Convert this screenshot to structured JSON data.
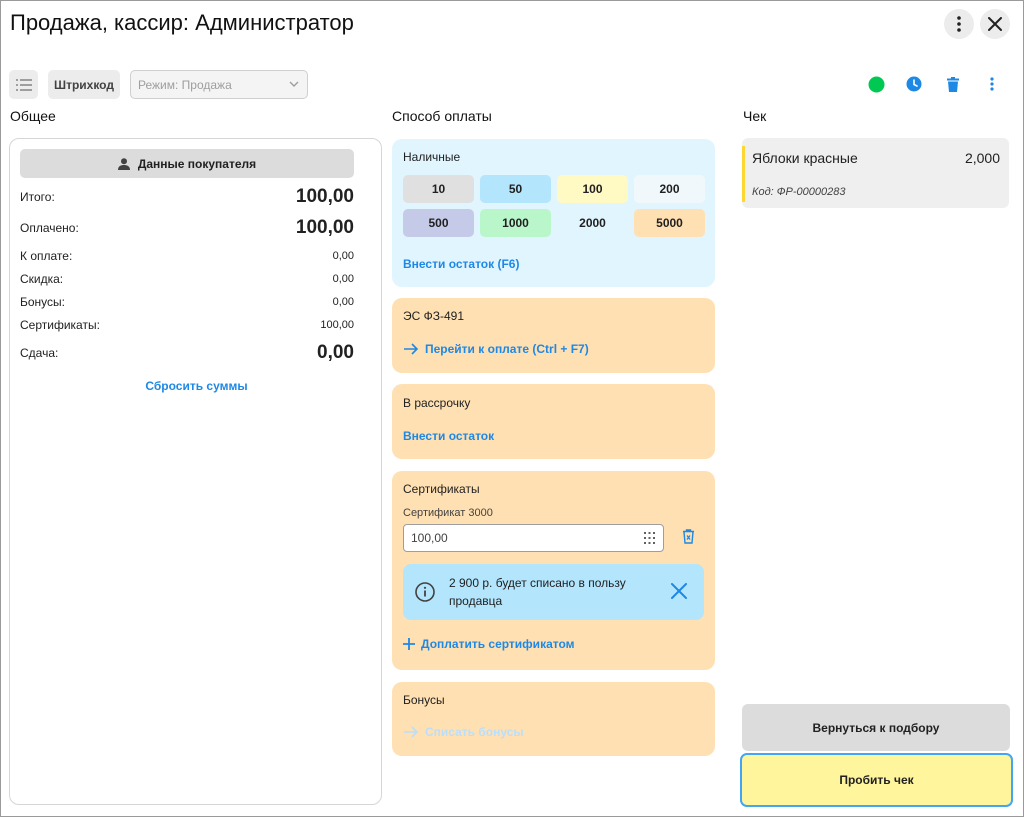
{
  "header": {
    "title": "Продажа, кассир: Администратор"
  },
  "toolbar": {
    "barcode_label": "Штрихкод",
    "mode_placeholder": "Режим: Продажа",
    "status_color": "#00c853"
  },
  "columns": {
    "general": "Общее",
    "payment": "Способ оплаты",
    "receipt": "Чек"
  },
  "summary": {
    "buyer_button": "Данные покупателя",
    "rows": [
      {
        "label": "Итого:",
        "value": "100,00"
      },
      {
        "label": "Оплачено:",
        "value": "100,00"
      },
      {
        "label": "К оплате:",
        "value": "0,00"
      },
      {
        "label": "Скидка:",
        "value": "0,00"
      },
      {
        "label": "Бонусы:",
        "value": "0,00"
      },
      {
        "label": "Сертификаты:",
        "value": "100,00"
      },
      {
        "label": "Сдача:",
        "value": "0,00"
      }
    ],
    "reset_link": "Сбросить суммы"
  },
  "payment": {
    "cash": {
      "title": "Наличные",
      "denominations": [
        {
          "label": "10",
          "color": "#e0e0e0"
        },
        {
          "label": "50",
          "color": "#b3e5fc"
        },
        {
          "label": "100",
          "color": "#fff9c4"
        },
        {
          "label": "200",
          "color": "#f1f8fb"
        },
        {
          "label": "500",
          "color": "#c5cae9"
        },
        {
          "label": "1000",
          "color": "#b9f6ca"
        },
        {
          "label": "2000",
          "color": "#e1f5fe"
        },
        {
          "label": "5000",
          "color": "#ffe0b2"
        }
      ],
      "rest_link": "Внести остаток (F6)"
    },
    "es": {
      "title": "ЭС ФЗ-491",
      "link": "Перейти к оплате (Ctrl + F7)"
    },
    "installment": {
      "title": "В рассрочку",
      "link": "Внести остаток"
    },
    "certificates": {
      "title": "Сертификаты",
      "cert_label": "Сертификат 3000",
      "cert_value": "100,00",
      "info_text": "2 900 р. будет списано в пользу продавца",
      "add_link": "Доплатить сертификатом"
    },
    "bonuses": {
      "title": "Бонусы",
      "link": "Списать бонусы"
    }
  },
  "receipt": {
    "items": [
      {
        "name": "Яблоки красные",
        "qty": "2,000",
        "code": "Код: ФР-00000283"
      }
    ],
    "back_button": "Вернуться к подбору",
    "print_button": "Пробить чек"
  }
}
